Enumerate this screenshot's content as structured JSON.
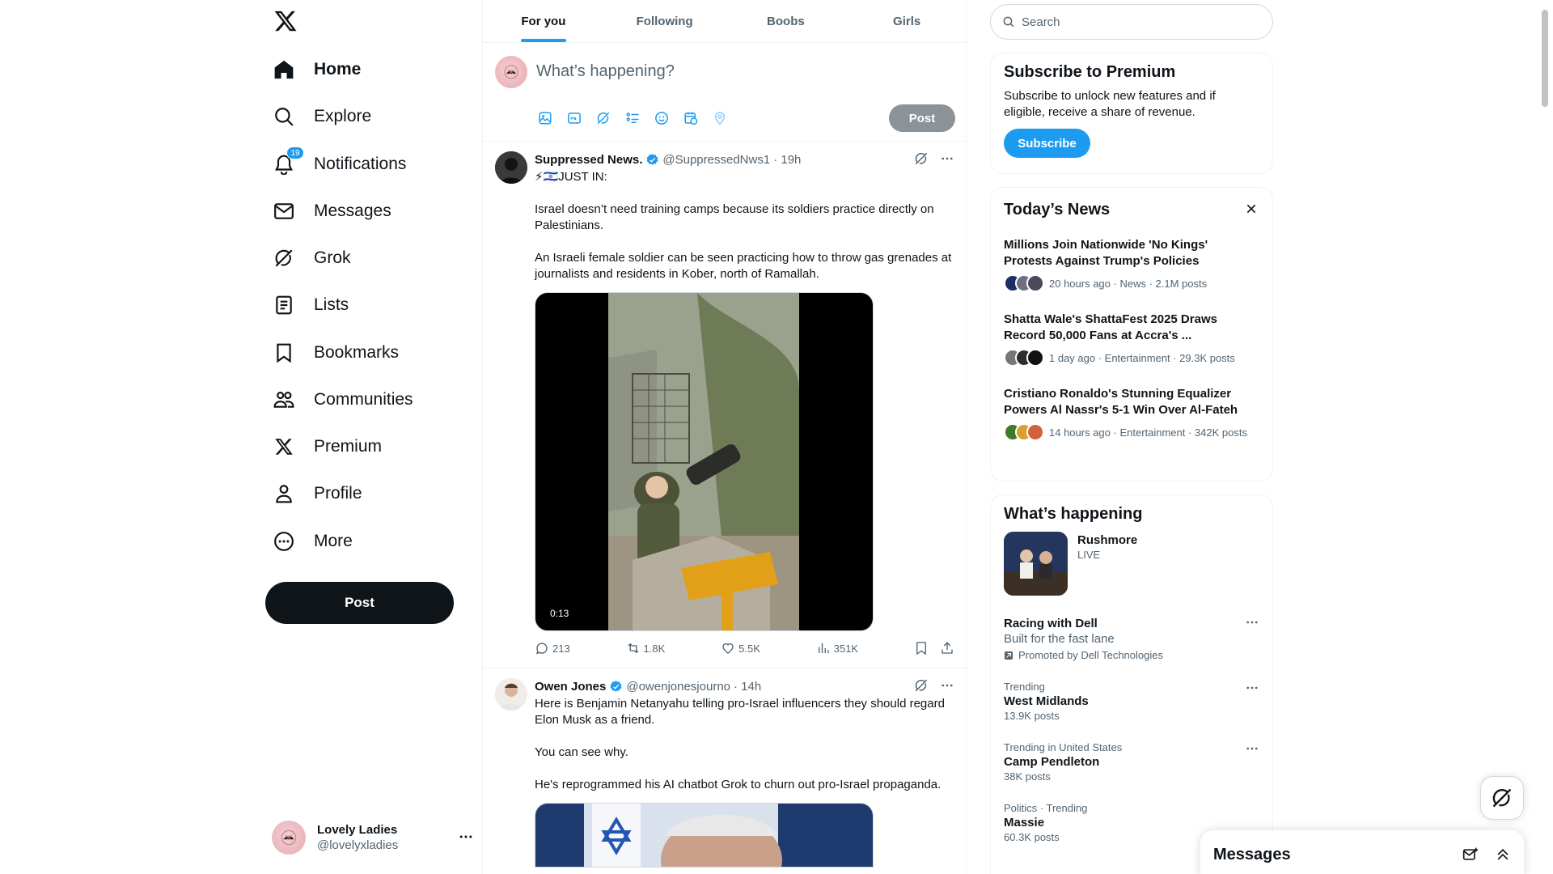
{
  "nav": {
    "items": [
      {
        "label": "Home",
        "icon": "home-icon"
      },
      {
        "label": "Explore",
        "icon": "search-icon"
      },
      {
        "label": "Notifications",
        "icon": "bell-icon",
        "badge": "19"
      },
      {
        "label": "Messages",
        "icon": "envelope-icon"
      },
      {
        "label": "Grok",
        "icon": "grok-icon"
      },
      {
        "label": "Lists",
        "icon": "list-icon"
      },
      {
        "label": "Bookmarks",
        "icon": "bookmark-icon"
      },
      {
        "label": "Communities",
        "icon": "people-icon"
      },
      {
        "label": "Premium",
        "icon": "x-logo-icon"
      },
      {
        "label": "Profile",
        "icon": "person-icon"
      },
      {
        "label": "More",
        "icon": "more-circle-icon"
      }
    ],
    "post_label": "Post",
    "account": {
      "name": "Lovely Ladies",
      "handle": "@lovelyxladies"
    }
  },
  "tabs": [
    "For you",
    "Following",
    "Boobs",
    "Girls"
  ],
  "compose": {
    "placeholder": "What’s happening?",
    "post_label": "Post"
  },
  "tweets": [
    {
      "name": "Suppressed News.",
      "handle": "@SuppressedNws1",
      "time": "· 19h",
      "lead": "⚡🇮🇱JUST IN:",
      "paragraphs": [
        "Israel doesn’t need training camps because its soldiers practice directly on Palestinians.",
        "An Israeli female soldier can be seen practicing how to throw gas grenades at journalists and residents in Kober, north of Ramallah."
      ],
      "video_duration": "0:13",
      "replies": "213",
      "reposts": "1.8K",
      "likes": "5.5K",
      "views": "351K"
    },
    {
      "name": "Owen Jones",
      "handle": "@owenjonesjourno",
      "time": "· 14h",
      "paragraphs": [
        "Here is Benjamin Netanyahu telling pro-Israel influencers they should regard Elon Musk as a friend.",
        "You can see why.",
        "He's reprogrammed his AI chatbot Grok to churn out pro-Israel propaganda."
      ]
    }
  ],
  "search": {
    "placeholder": "Search"
  },
  "premium": {
    "title": "Subscribe to Premium",
    "text": "Subscribe to unlock new features and if eligible, receive a share of revenue.",
    "button": "Subscribe"
  },
  "news": {
    "title": "Today’s News",
    "items": [
      {
        "title": "Millions Join Nationwide 'No Kings' Protests Against Trump's Policies",
        "meta": "20 hours ago · News · 2.1M posts"
      },
      {
        "title": "Shatta Wale's ShattaFest 2025 Draws Record 50,000 Fans at Accra's ...",
        "meta": "1 day ago · Entertainment · 29.3K posts"
      },
      {
        "title": "Cristiano Ronaldo's Stunning Equalizer Powers Al Nassr's 5-1 Win Over Al-Fateh",
        "meta": "14 hours ago · Entertainment · 342K posts"
      }
    ]
  },
  "happening": {
    "title": "What’s happening",
    "live": {
      "title": "Rushmore",
      "status": "LIVE"
    },
    "promo": {
      "title": "Racing with Dell",
      "subtitle": "Built for the fast lane",
      "promoted": "Promoted by Dell Technologies"
    },
    "trends": [
      {
        "context": "Trending",
        "title": "West Midlands",
        "posts": "13.9K posts"
      },
      {
        "context": "Trending in United States",
        "title": "Camp Pendleton",
        "posts": "38K posts"
      },
      {
        "context": "Politics · Trending",
        "title": "Massie",
        "posts": "60.3K posts"
      }
    ]
  },
  "messages_drawer": {
    "title": "Messages"
  },
  "colors": {
    "accent": "#1d9bf0",
    "text": "#0f1419",
    "muted": "#536471"
  }
}
